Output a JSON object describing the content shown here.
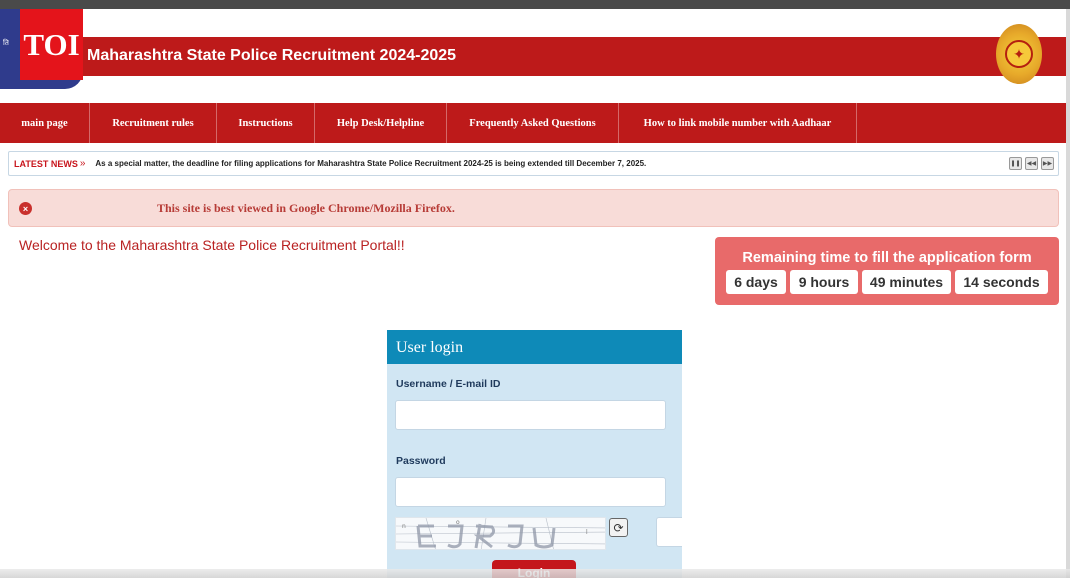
{
  "header": {
    "badge": "TOI",
    "logo_hint": "ति",
    "title": "Maharashtra State Police Recruitment 2024-2025"
  },
  "nav": {
    "items": [
      {
        "label": "main page"
      },
      {
        "label": "Recruitment rules"
      },
      {
        "label": "Instructions"
      },
      {
        "label": "Help Desk/Helpline"
      },
      {
        "label": "Frequently Asked Questions"
      },
      {
        "label": "How to link mobile number with Aadhaar"
      }
    ]
  },
  "news": {
    "label": "LATEST NEWS",
    "chevron": "»",
    "text": "As a special matter, the deadline for filing applications for Maharashtra State Police Recruitment 2024-25 is being extended till December 7, 2025.",
    "controls": [
      {
        "icon": "pause-icon",
        "glyph": "❚❚"
      },
      {
        "icon": "previous-icon",
        "glyph": "◀◀"
      },
      {
        "icon": "next-icon",
        "glyph": "▶▶"
      }
    ]
  },
  "alert": {
    "icon": "close-circle-icon",
    "glyph": "×",
    "text": "This site is best viewed in Google Chrome/Mozilla Firefox."
  },
  "welcome": {
    "text": "Welcome to the Maharashtra State Police Recruitment Portal!!"
  },
  "countdown": {
    "title": "Remaining time to fill the application form",
    "days": "6 days",
    "hours": "9 hours",
    "minutes": "49 minutes",
    "seconds": "14 seconds"
  },
  "login": {
    "title": "User login",
    "username_label": "Username / E-mail ID",
    "username_value": "",
    "password_label": "Password",
    "password_value": "",
    "captcha_value": "",
    "refresh_glyph": "⟳",
    "button_label": "Login"
  },
  "colors": {
    "brand_red": "#bd1a1a",
    "login_header": "#0e8ab8",
    "login_panel": "#d1e6f3",
    "countdown_bg": "#e86a6a"
  }
}
